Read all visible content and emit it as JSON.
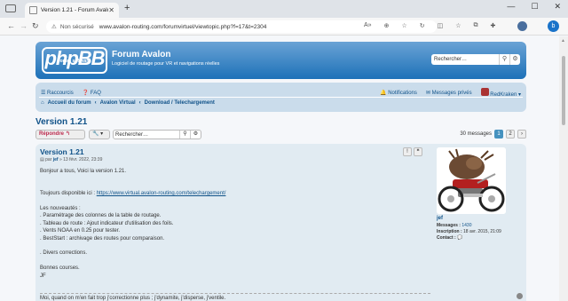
{
  "browser": {
    "tab_title": "Version 1.21 - Forum Avalon",
    "tab_close": "✕",
    "new_tab": "+",
    "url_warning": "Non sécurisé",
    "url": "www.avalon-routing.com/forumvirtuel/viewtopic.php?f=17&t=2304",
    "win_min": "—",
    "win_max": "☐",
    "win_close": "✕"
  },
  "header": {
    "logo_text": "phpBB",
    "logo_sub": "forum software",
    "site_name": "Forum Avalon",
    "site_desc": "Logiciel de routage pour VR et navigations réelles",
    "search_placeholder": "Rechercher…"
  },
  "navbar": {
    "quick_links": "Raccourcis",
    "faq": "FAQ",
    "notifications": "Notifications",
    "private_messages": "Messages privés",
    "username": "RedKraken",
    "breadcrumbs": [
      "Accueil du forum",
      "Avalon Virtual",
      "Download / Telechargement"
    ]
  },
  "topic": {
    "title": "Version 1.21",
    "reply_label": "Répondre",
    "search_placeholder": "Rechercher…",
    "message_count": "30 messages",
    "pages": [
      "1",
      "2"
    ]
  },
  "post": {
    "title": "Version 1.21",
    "meta_prefix": "par",
    "author": "jef",
    "meta_date": "» 13 févr. 2022, 23:39",
    "lines": [
      "Bonjour a tous, Voici la version 1.21.",
      "",
      "",
      "Toujours disponible ici : ",
      "",
      "Les nouveautés :",
      ". Paramétrage des colonnes de la table de routage.",
      ". Tableau de route : Ajout indicateur d'utilisation des foils.",
      ". Vents NOAA en 0.25 pour tester.",
      ". BestStart : archivage des routes pour comparaison.",
      "",
      ". Divers corrections.",
      "",
      "Bonnes courses.",
      "JF"
    ],
    "link": "https://www.virtual.avalon-routing.com/telechargement/",
    "signature": "Moi, quand on m'en fait trop j'correctionne plus ; j'dynamite, j'disperse, j'ventile."
  },
  "profile": {
    "name": "jef",
    "messages_label": "Messages :",
    "messages_value": "1430",
    "registered_label": "Inscription :",
    "registered_value": "18 avr. 2015, 21:09",
    "contact_label": "Contact :"
  },
  "colors": {
    "header_gradient_top": "#6aa3d5",
    "header_gradient_bottom": "#1d71b8",
    "link": "#105289",
    "reply": "#bc2a4d",
    "post_bg": "#e1ebf2"
  }
}
